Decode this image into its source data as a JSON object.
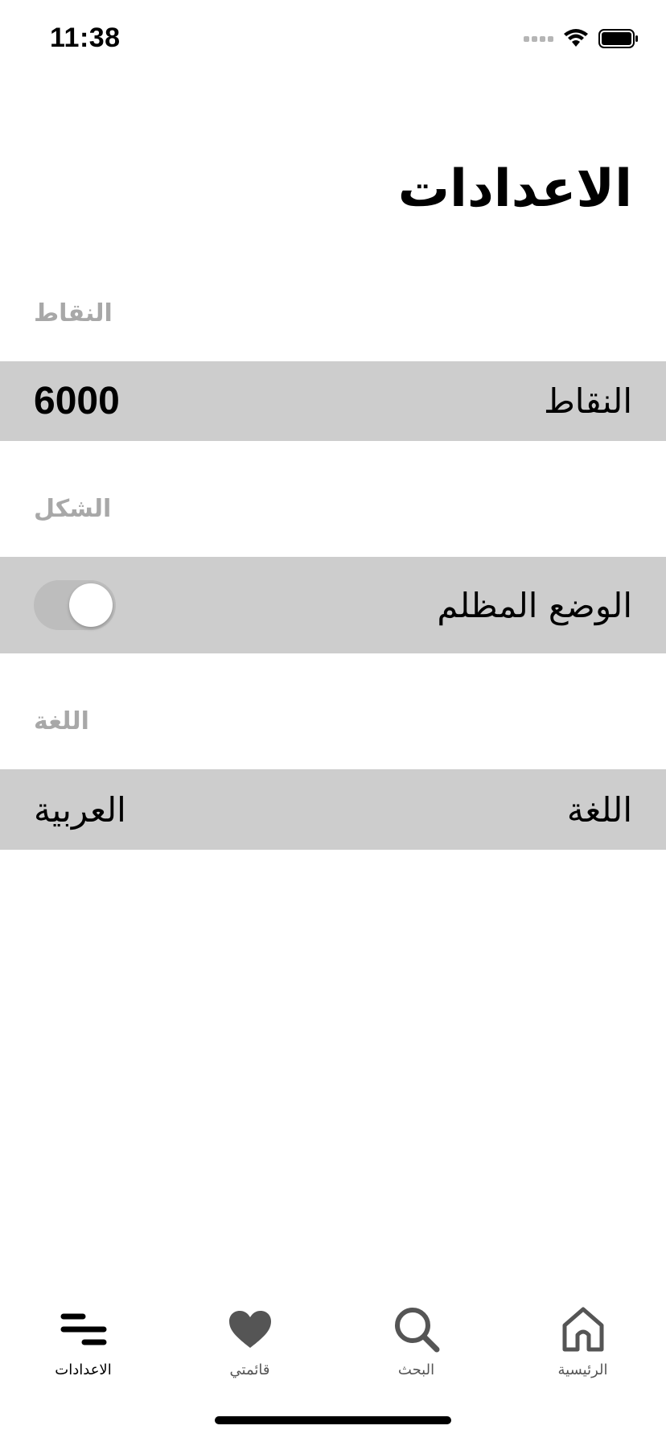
{
  "status_bar": {
    "time": "11:38"
  },
  "page": {
    "title": "الاعدادات"
  },
  "sections": {
    "points": {
      "header": "النقاط",
      "row_label": "النقاط",
      "row_value": "6000"
    },
    "appearance": {
      "header": "الشكل",
      "row_label": "الوضع المظلم",
      "dark_mode_on": false
    },
    "language": {
      "header": "اللغة",
      "row_label": "اللغة",
      "row_value": "العربية"
    }
  },
  "tab_bar": {
    "active": "settings",
    "tabs": [
      {
        "id": "settings",
        "label": "الاعدادات",
        "icon": "settings-lines-icon"
      },
      {
        "id": "my-list",
        "label": "قائمتي",
        "icon": "heart-icon"
      },
      {
        "id": "search",
        "label": "البحث",
        "icon": "search-icon"
      },
      {
        "id": "home",
        "label": "الرئيسية",
        "icon": "home-icon"
      }
    ]
  },
  "colors": {
    "row_background": "#cdcdcd",
    "section_header": "#a8a8a8",
    "toggle_track_off": "#bdbdbd"
  }
}
